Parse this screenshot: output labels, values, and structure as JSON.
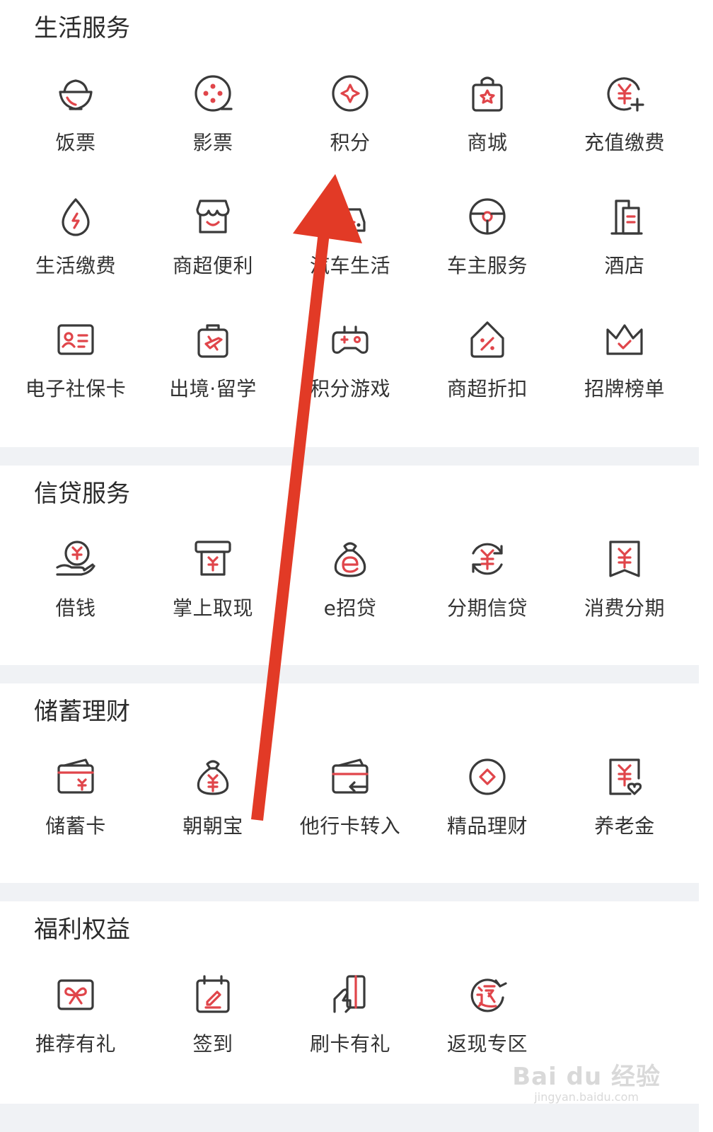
{
  "colors": {
    "accent": "#e0454a",
    "stroke": "#3a3a3a",
    "arrow": "#e23a26",
    "divider": "#f0f2f5"
  },
  "sections": [
    {
      "title": "生活服务",
      "items": [
        {
          "label": "饭票",
          "icon": "rice-bowl-icon"
        },
        {
          "label": "影票",
          "icon": "film-reel-icon"
        },
        {
          "label": "积分",
          "icon": "points-star-icon"
        },
        {
          "label": "商城",
          "icon": "shopping-bag-icon"
        },
        {
          "label": "充值缴费",
          "icon": "recharge-yuan-icon"
        },
        {
          "label": "生活缴费",
          "icon": "utility-drop-icon"
        },
        {
          "label": "商超便利",
          "icon": "store-icon"
        },
        {
          "label": "汽车生活",
          "icon": "car-life-icon"
        },
        {
          "label": "车主服务",
          "icon": "steering-wheel-icon"
        },
        {
          "label": "酒店",
          "icon": "hotel-building-icon"
        },
        {
          "label": "电子社保卡",
          "icon": "id-card-icon"
        },
        {
          "label": "出境·留学",
          "icon": "travel-bag-icon"
        },
        {
          "label": "积分游戏",
          "icon": "gamepad-icon"
        },
        {
          "label": "商超折扣",
          "icon": "discount-tag-icon"
        },
        {
          "label": "招牌榜单",
          "icon": "crown-icon"
        }
      ]
    },
    {
      "title": "信贷服务",
      "items": [
        {
          "label": "借钱",
          "icon": "hand-coin-icon"
        },
        {
          "label": "掌上取现",
          "icon": "atm-cash-icon"
        },
        {
          "label": "e招贷",
          "icon": "money-bag-e-icon"
        },
        {
          "label": "分期信贷",
          "icon": "yuan-cycle-icon"
        },
        {
          "label": "消费分期",
          "icon": "yuan-bookmark-icon"
        }
      ]
    },
    {
      "title": "储蓄理财",
      "items": [
        {
          "label": "储蓄卡",
          "icon": "debit-card-icon"
        },
        {
          "label": "朝朝宝",
          "icon": "money-bag-yuan-icon"
        },
        {
          "label": "他行卡转入",
          "icon": "card-transfer-icon"
        },
        {
          "label": "精品理财",
          "icon": "diamond-circle-icon"
        },
        {
          "label": "养老金",
          "icon": "pension-doc-icon"
        }
      ]
    },
    {
      "title": "福利权益",
      "items": [
        {
          "label": "推荐有礼",
          "icon": "gift-card-icon"
        },
        {
          "label": "签到",
          "icon": "calendar-sign-icon"
        },
        {
          "label": "刷卡有礼",
          "icon": "hand-card-icon"
        },
        {
          "label": "返现专区",
          "icon": "cashback-icon"
        }
      ]
    }
  ],
  "watermark": {
    "logo": "Bai du 经验",
    "url": "jingyan.baidu.com"
  }
}
